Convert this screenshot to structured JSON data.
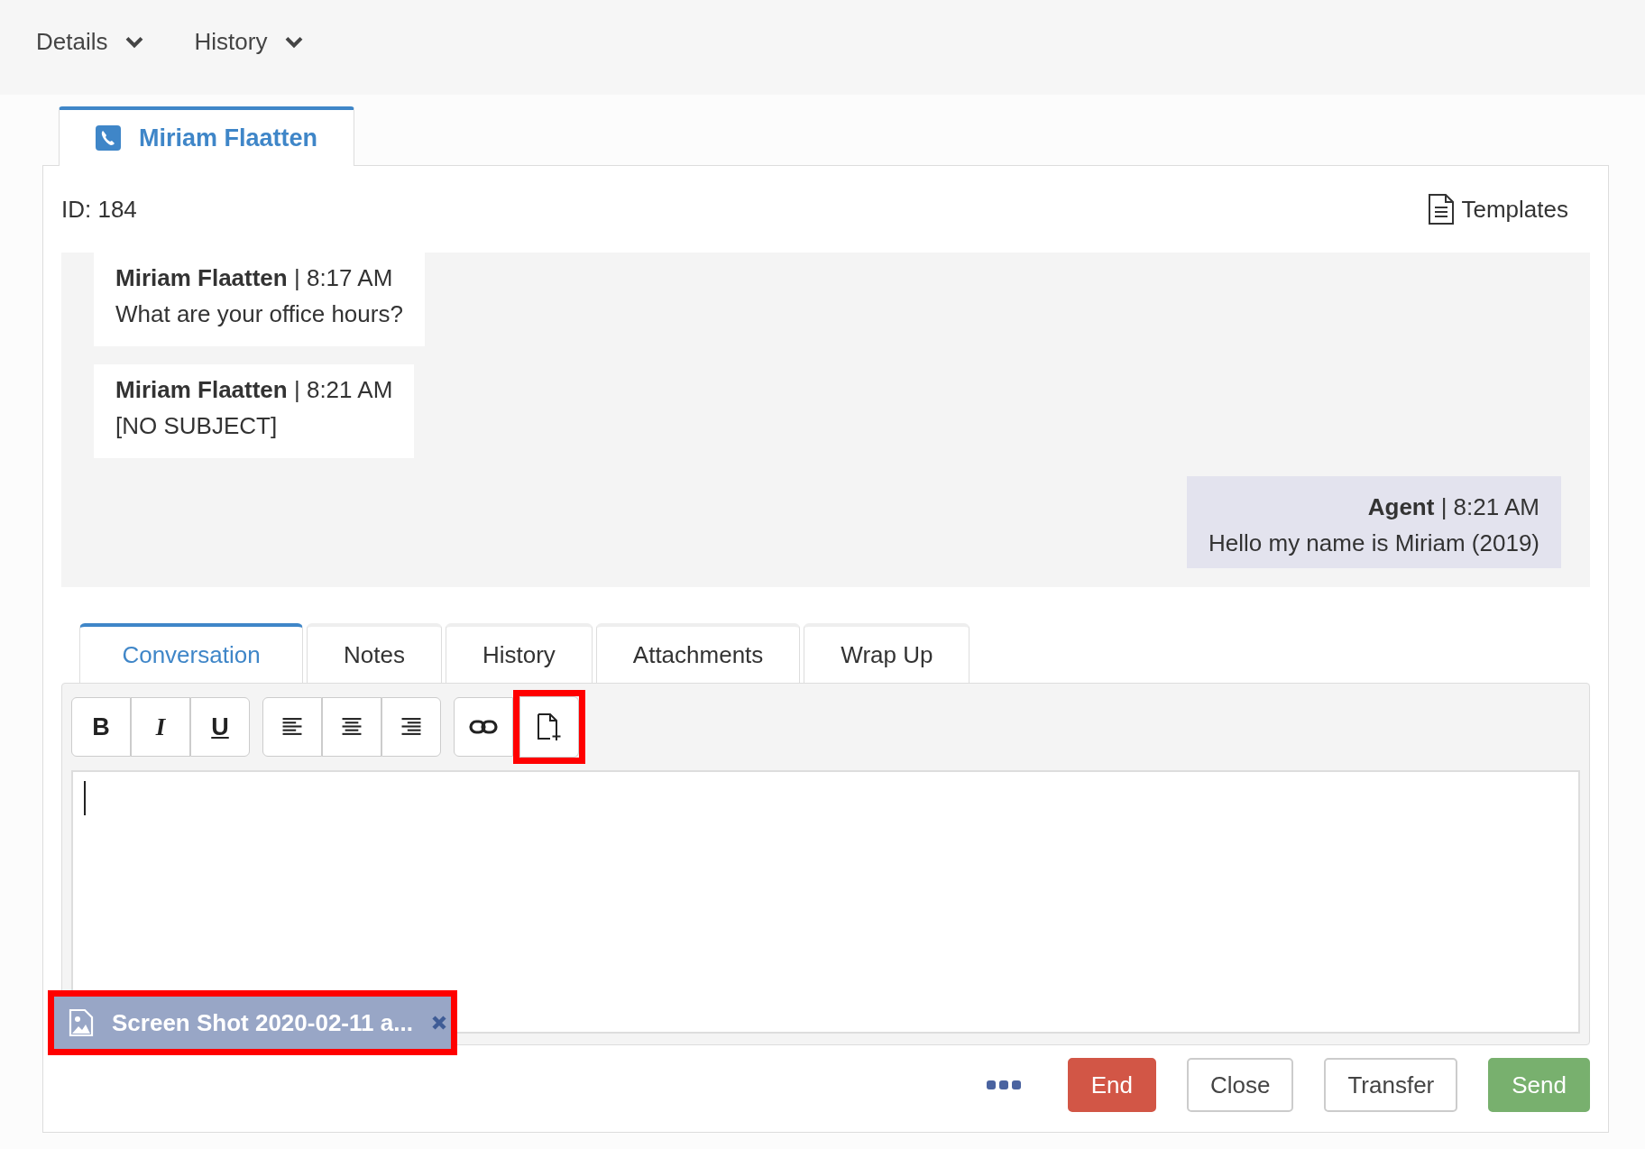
{
  "top_nav": [
    {
      "label": "Details"
    },
    {
      "label": "History"
    }
  ],
  "contact_tab": {
    "label": "Miriam Flaatten",
    "selected": true
  },
  "id_label": "ID: 184",
  "templates_button": {
    "label": "Templates"
  },
  "messages": [
    {
      "kind": "customer",
      "header": "**Miriam Flaatten** | 8:17 AM",
      "text": "What are your office hours?"
    },
    {
      "kind": "customer",
      "header": "**Miriam Flaatten** | 8:21 AM",
      "text": "[NO SUBJECT]"
    },
    {
      "kind": "agent",
      "header": "**Agent** | 8:21 AM",
      "text": "Hello my name is Miriam (2019)"
    }
  ],
  "tabs": [
    {
      "label": "Conversation",
      "selected": true
    },
    {
      "label": "Notes",
      "selected": false
    },
    {
      "label": "History",
      "selected": false
    },
    {
      "label": "Attachments",
      "selected": false
    },
    {
      "label": "Wrap Up",
      "selected": false
    }
  ],
  "toolbar": [
    [
      {
        "kind": "bold",
        "label": "B",
        "highlighted": false
      },
      {
        "kind": "italic",
        "label": "I",
        "highlighted": false
      },
      {
        "kind": "underline",
        "label": "U",
        "highlighted": false
      }
    ],
    [
      {
        "kind": "align_left",
        "highlighted": false
      },
      {
        "kind": "align_center",
        "highlighted": false
      },
      {
        "kind": "align_right",
        "highlighted": false
      }
    ],
    [
      {
        "kind": "link",
        "highlighted": false
      },
      {
        "kind": "attach",
        "highlighted": true
      }
    ]
  ],
  "attachment": {
    "name": "Screen Shot 2020-02-11 a...",
    "highlighted": true
  },
  "actions": [
    {
      "kind": "end",
      "label": "End"
    },
    {
      "kind": "close",
      "label": "Close"
    },
    {
      "kind": "transfer",
      "label": "Transfer"
    },
    {
      "kind": "send",
      "label": "Send"
    }
  ]
}
